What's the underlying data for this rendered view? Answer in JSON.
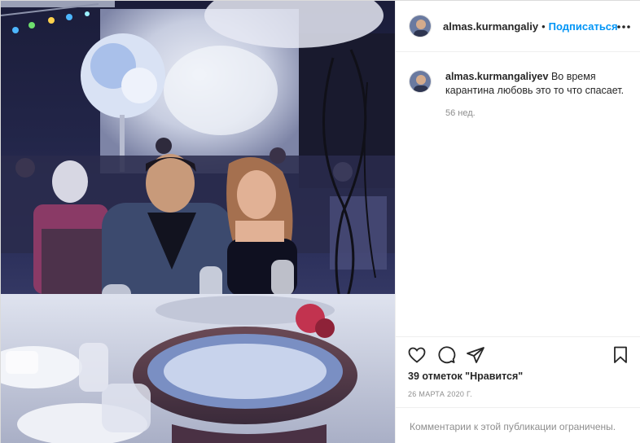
{
  "post": {
    "author": {
      "username": "almas.kurmangaliyev",
      "username_truncated": "almas.kurmangaliy",
      "avatar_icon": "profile-avatar"
    },
    "header": {
      "separator": "•",
      "follow_label": "Подписаться",
      "more_icon": "more-horizontal-icon"
    },
    "caption": {
      "username": "almas.kurmangaliyev",
      "text": "Во время карантина любовь это то что спасает.",
      "time_ago": "56 нед."
    },
    "actions": {
      "like_icon": "heart-icon",
      "comment_icon": "comment-icon",
      "share_icon": "share-icon",
      "save_icon": "bookmark-icon"
    },
    "likes_text": "39 отметок \"Нравится\"",
    "date": "26 МАРТА 2020 Г.",
    "comments_disabled": "Комментарии к этой публикации ограничены."
  },
  "colors": {
    "accent": "#0095f6",
    "text_primary": "#262626",
    "text_secondary": "#8e8e8e",
    "divider": "#efefef"
  }
}
